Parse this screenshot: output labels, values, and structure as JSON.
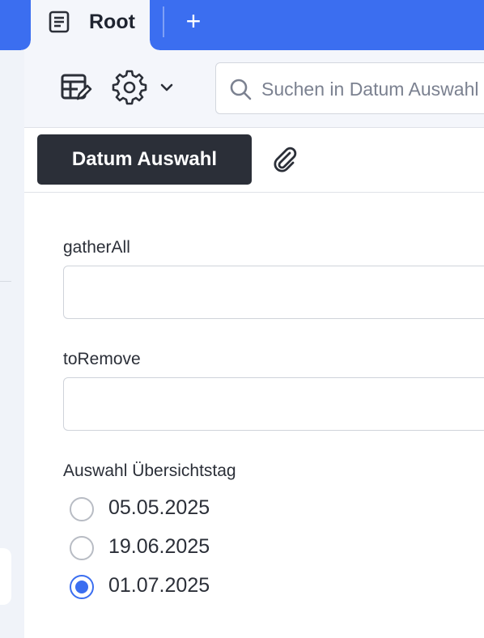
{
  "tabbar": {
    "active_tab_label": "Root",
    "add_tab_symbol": "+"
  },
  "toolbar": {
    "search_placeholder": "Suchen in Datum Auswahl"
  },
  "subbar": {
    "active_section_label": "Datum Auswahl"
  },
  "form": {
    "fields": [
      {
        "label": "gatherAll",
        "value": ""
      },
      {
        "label": "toRemove",
        "value": ""
      }
    ],
    "radio_group": {
      "label": "Auswahl Übersichtstag",
      "options": [
        "05.05.2025",
        "19.06.2025",
        "01.07.2025"
      ],
      "selected": "01.07.2025"
    }
  },
  "colors": {
    "accent": "#3b6ef0",
    "dark_button": "#2b2f38"
  },
  "icons": [
    "document-icon",
    "plus-icon",
    "form-edit-icon",
    "gear-icon",
    "chevron-down-icon",
    "search-icon",
    "paperclip-icon"
  ]
}
